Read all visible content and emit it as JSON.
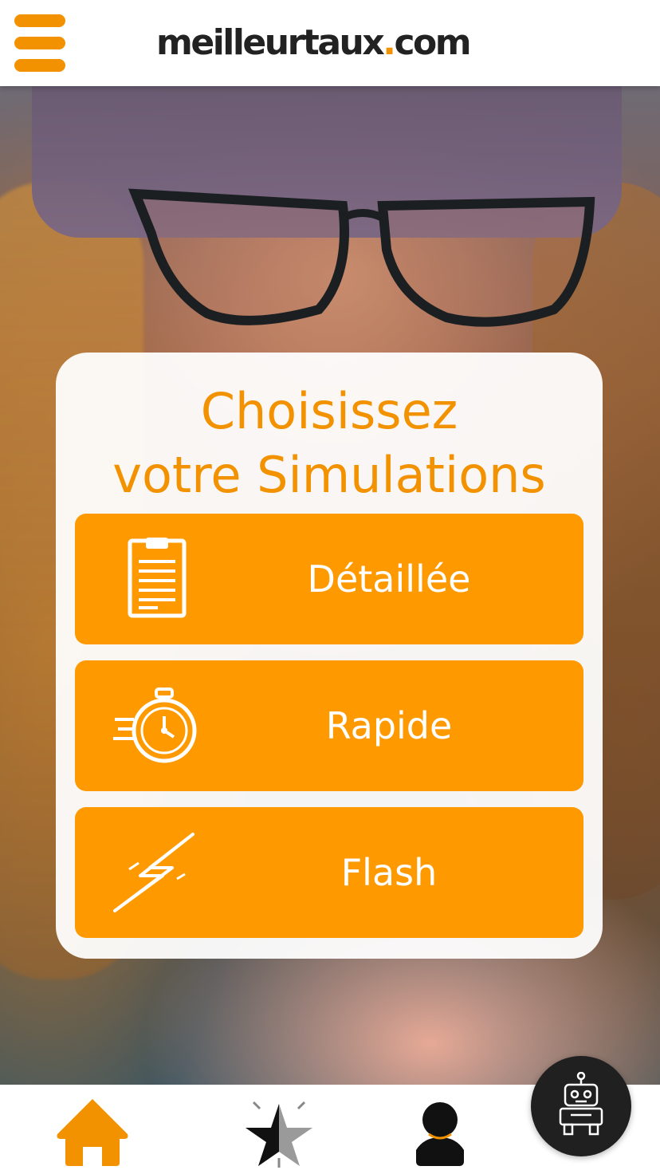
{
  "header": {
    "logo_text": "meilleurtaux",
    "logo_dot": ".",
    "logo_suffix": "com",
    "menu_icon": "hamburger-menu-icon"
  },
  "card": {
    "title_line1": "Choisissez",
    "title_line2": "votre Simulations",
    "options": [
      {
        "label": "Détaillée",
        "icon": "clipboard-icon"
      },
      {
        "label": "Rapide",
        "icon": "stopwatch-icon"
      },
      {
        "label": "Flash",
        "icon": "lightning-icon"
      }
    ]
  },
  "bottom_nav": [
    {
      "icon": "home-icon"
    },
    {
      "icon": "star-icon"
    },
    {
      "icon": "user-icon"
    }
  ],
  "chatbot": {
    "icon": "robot-icon"
  },
  "colors": {
    "accent": "#F39200",
    "button": "#FF9900",
    "card_bg": "#FFFFFF",
    "chatbot_bg": "#202020"
  }
}
